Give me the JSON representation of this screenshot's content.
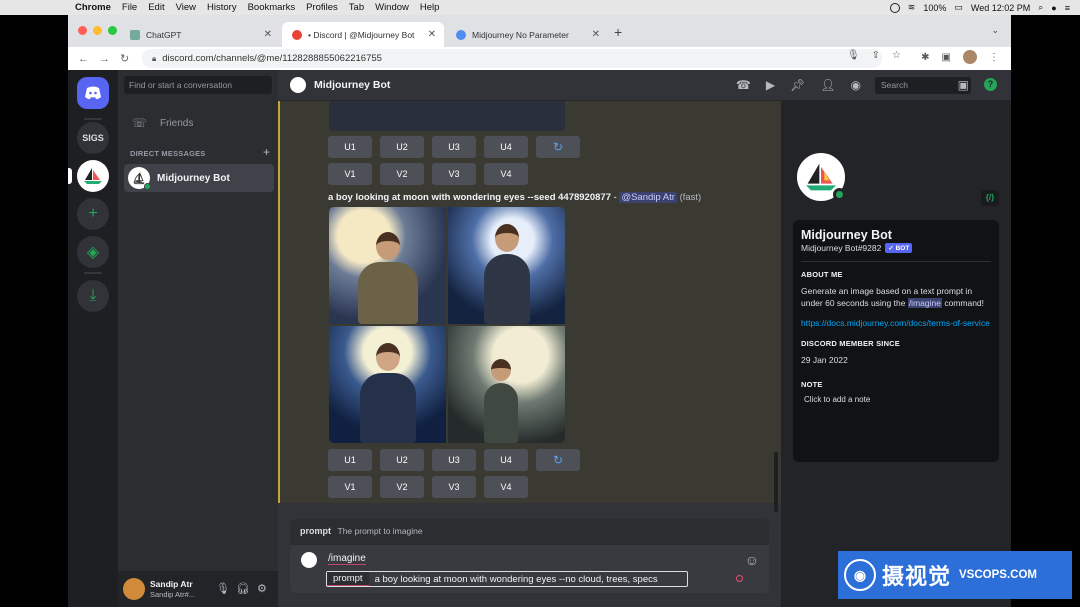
{
  "menubar": {
    "app": "Chrome",
    "items": [
      "File",
      "Edit",
      "View",
      "History",
      "Bookmarks",
      "Profiles",
      "Tab",
      "Window",
      "Help"
    ],
    "battery": "100%",
    "clock": "Wed 12:02 PM"
  },
  "browser": {
    "tabs": [
      {
        "title": "ChatGPT",
        "color": "#74aa9c"
      },
      {
        "title": "• Discord | @Midjourney Bot",
        "color": "#ea4335"
      },
      {
        "title": "Midjourney No Parameter",
        "color": "#4d8ef0"
      }
    ],
    "url": "discord.com/channels/@me/1128288855062216755"
  },
  "servers": {
    "home_icon": "discord-icon",
    "sigs_label": "SIGS",
    "add_icon": "+",
    "explore_icon": "compass-icon",
    "download_icon": "download-icon"
  },
  "dm_sidebar": {
    "search_placeholder": "Find or start a conversation",
    "friends_label": "Friends",
    "direct_messages_header": "DIRECT MESSAGES",
    "add_dm_icon": "+",
    "dm_items": [
      {
        "name": "Midjourney Bot"
      }
    ]
  },
  "user_panel": {
    "name": "Sandip Atr",
    "sub": "Sandip Atr#..."
  },
  "chat": {
    "title": "Midjourney Bot",
    "search_placeholder": "Search",
    "buttons_upscale": [
      "U1",
      "U2",
      "U3",
      "U4"
    ],
    "buttons_variation": [
      "V1",
      "V2",
      "V3",
      "V4"
    ],
    "refresh_icon": "↻",
    "message": {
      "prompt": "a boy looking at moon with wondering eyes --seed 4478920877",
      "separator": " - ",
      "mention": "@Sandip Atr",
      "speed": "(fast)"
    },
    "composer": {
      "option_name": "prompt",
      "option_desc": "The prompt to imagine",
      "command": "/imagine",
      "chip_label": "prompt",
      "input_value": "a boy looking at moon with wondering eyes --no cloud, trees, specs"
    }
  },
  "profile": {
    "name": "Midjourney Bot",
    "tag": "Midjourney Bot#9282",
    "badge": "✓ BOT",
    "code_badge": "{/}",
    "about_header": "ABOUT ME",
    "about_text_1": "Generate an image based on a text prompt in under 60 seconds using the",
    "about_cmd": "/imagine",
    "about_text_2": "command!",
    "link": "https://docs.midjourney.com/docs/terms-of-service",
    "member_since_header": "DISCORD MEMBER SINCE",
    "member_since": "29 Jan 2022",
    "note_header": "NOTE",
    "note_placeholder": "Click to add a note"
  },
  "watermark": {
    "cn": "摄视觉",
    "en": "VSCOPS.COM"
  }
}
